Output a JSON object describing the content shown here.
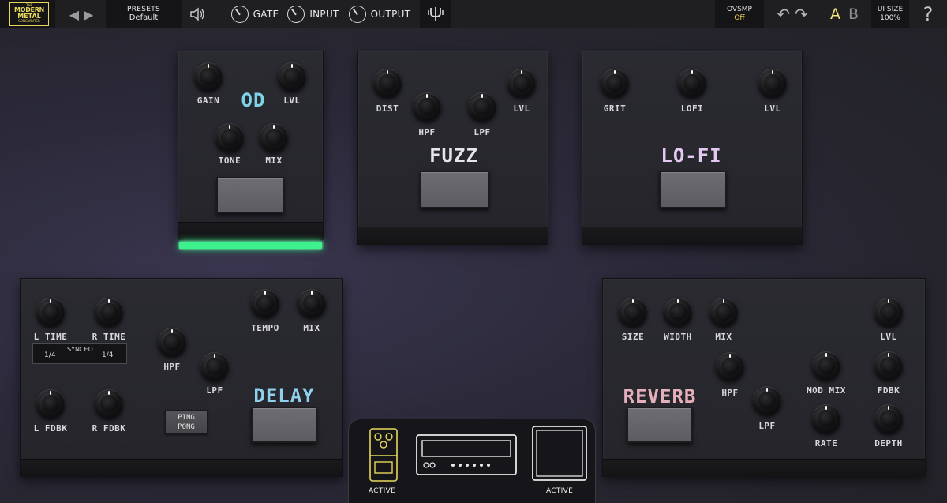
{
  "brand": {
    "line1": "THE",
    "line2": "MODERN",
    "line3": "METAL",
    "line4": "SONGWRITER"
  },
  "presets": {
    "title": "PRESETS",
    "value": "Default"
  },
  "controls": {
    "gate": "GATE",
    "input": "INPUT",
    "output": "OUTPUT"
  },
  "ovsmp": {
    "title": "OVSMP",
    "value": "Off"
  },
  "ab": {
    "a": "A",
    "b": "B"
  },
  "uisize": {
    "title": "UI SIZE",
    "value": "100%"
  },
  "help": "?",
  "colors": {
    "accent": "#f4d64c",
    "led_active": "#3df28e",
    "od_title": "#7fd3e8",
    "lofi_title": "#e3c9f2",
    "reverb_title": "#e5b0bb"
  },
  "pedals": {
    "od": {
      "title": "OD",
      "knobs": [
        "GAIN",
        "LVL",
        "TONE",
        "MIX"
      ],
      "active": true
    },
    "fuzz": {
      "title": "FUZZ",
      "knobs": [
        "DIST",
        "HPF",
        "LPF",
        "LVL"
      ]
    },
    "lofi": {
      "title": "LO-FI",
      "knobs": [
        "GRIT",
        "LOFI",
        "LVL"
      ]
    },
    "delay": {
      "title": "DELAY",
      "knobs": [
        "L TIME",
        "R TIME",
        "HPF",
        "LPF",
        "TEMPO",
        "MIX",
        "L FDBK",
        "R FDBK"
      ],
      "synced": {
        "label": "SYNCED",
        "left": "1/4",
        "right": "1/4"
      },
      "pingpong": {
        "line1": "PING",
        "line2": "PONG"
      }
    },
    "reverb": {
      "title": "REVERB",
      "knobs": [
        "SIZE",
        "WIDTH",
        "MIX",
        "LVL",
        "HPF",
        "LPF",
        "MOD MIX",
        "FDBK",
        "RATE",
        "DEPTH"
      ]
    }
  },
  "chain": {
    "pedal_status": "ACTIVE",
    "cab_status": "ACTIVE"
  }
}
